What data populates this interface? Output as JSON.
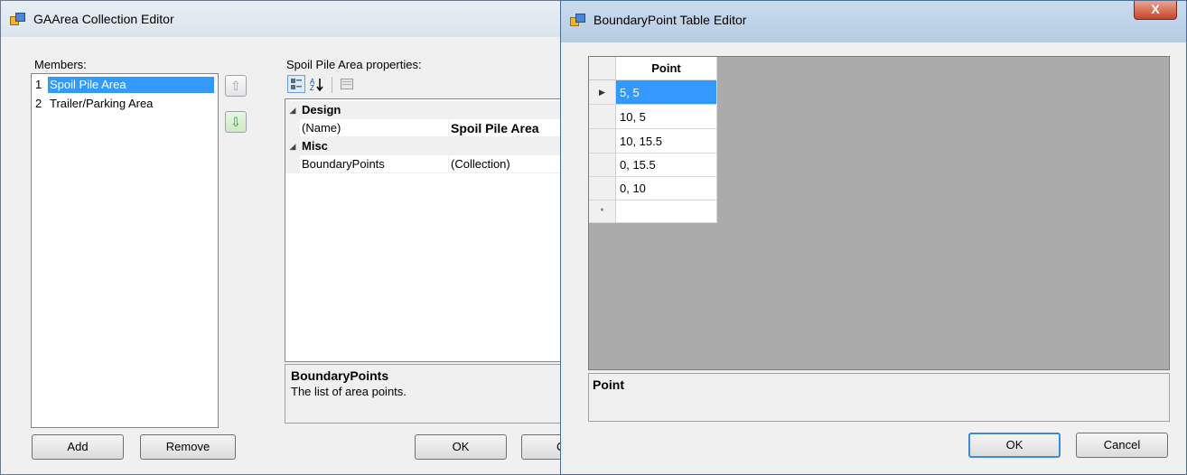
{
  "collection_editor": {
    "title": "GAArea Collection Editor",
    "members_label": "Members:",
    "members": [
      {
        "index": "1",
        "name": "Spoil Pile Area",
        "selected": true
      },
      {
        "index": "2",
        "name": "Trailer/Parking Area",
        "selected": false
      }
    ],
    "properties_label": "Spoil Pile Area properties:",
    "property_grid": {
      "categories": [
        {
          "name": "Design",
          "rows": [
            {
              "name": "(Name)",
              "value": "Spoil Pile Area",
              "bold": true
            }
          ]
        },
        {
          "name": "Misc",
          "rows": [
            {
              "name": "BoundaryPoints",
              "value": "(Collection)",
              "bold": false
            }
          ]
        }
      ]
    },
    "description": {
      "title": "BoundaryPoints",
      "text": "The list of area points."
    },
    "buttons": {
      "add": "Add",
      "remove": "Remove",
      "ok": "OK",
      "cancel_partial": "Ca"
    }
  },
  "table_editor": {
    "title": "BoundaryPoint Table Editor",
    "close_glyph": "X",
    "column_header": "Point",
    "rows": [
      "5, 5",
      "10, 5",
      "10, 15.5",
      "0, 15.5",
      "0, 10"
    ],
    "selected_row": 0,
    "new_row_marker": "*",
    "current_row_marker": "▶",
    "description_title": "Point",
    "buttons": {
      "ok": "OK",
      "cancel": "Cancel"
    }
  },
  "icons": {
    "up_arrow": "arrow-up-icon",
    "down_arrow": "arrow-down-icon",
    "categorized": "categorized-icon",
    "alphabetical": "alphabetical-sort-icon",
    "property_pages": "property-pages-icon",
    "collapse": "collapse-triangle-icon"
  }
}
